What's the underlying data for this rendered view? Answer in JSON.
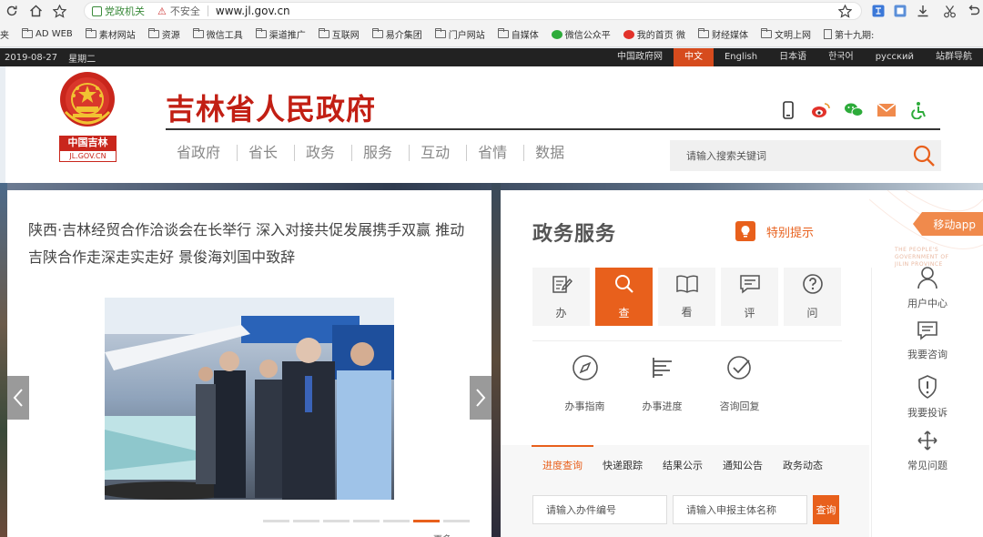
{
  "browser": {
    "badge": "党政机关",
    "insecure": "不安全",
    "url": "www.jl.gov.cn"
  },
  "bookmarks": [
    {
      "label": "夹",
      "icon": "none"
    },
    {
      "label": "AD WEB",
      "icon": "folder-icon"
    },
    {
      "label": "素材网站",
      "icon": "folder-icon"
    },
    {
      "label": "资源",
      "icon": "folder-icon"
    },
    {
      "label": "微信工具",
      "icon": "folder-icon"
    },
    {
      "label": "渠道推广",
      "icon": "folder-icon"
    },
    {
      "label": "互联网",
      "icon": "folder-icon"
    },
    {
      "label": "易介集团",
      "icon": "folder-icon"
    },
    {
      "label": "门户网站",
      "icon": "folder-icon"
    },
    {
      "label": "自媒体",
      "icon": "folder-icon"
    },
    {
      "label": "微信公众平",
      "icon": "wechat-icon"
    },
    {
      "label": "我的首页 微",
      "icon": "weibo-icon"
    },
    {
      "label": "财经媒体",
      "icon": "folder-icon"
    },
    {
      "label": "文明上网",
      "icon": "folder-icon"
    },
    {
      "label": "第十九期:",
      "icon": "document-icon"
    }
  ],
  "top_strip": {
    "date": "2019-08-27",
    "weekday": "星期二",
    "links": [
      {
        "label": "中国政府网",
        "active": false
      },
      {
        "label": "中文",
        "active": true
      },
      {
        "label": "English",
        "active": false
      },
      {
        "label": "日本语",
        "active": false
      },
      {
        "label": "한국어",
        "active": false
      },
      {
        "label": "русский",
        "active": false
      },
      {
        "label": "站群导航",
        "active": false
      }
    ]
  },
  "header": {
    "emblem_label": "中国吉林",
    "emblem_domain": "JL.GOV.CN",
    "title": "吉林省人民政府",
    "nav": [
      "省政府",
      "省长",
      "政务",
      "服务",
      "互动",
      "省情",
      "数据"
    ],
    "search_placeholder": "请输入搜索关键词"
  },
  "news": {
    "headline": "陕西·吉林经贸合作洽谈会在长举行 深入对接共促发展携手双赢 推动吉陕合作走深走实走好 景俊海刘国中致辞",
    "slide_count": 7,
    "active_slide": 6,
    "more": "更多"
  },
  "services": {
    "title": "政务服务",
    "notice": "特别提示",
    "tabs": [
      {
        "label": "办",
        "icon": "edit-icon",
        "active": false
      },
      {
        "label": "查",
        "icon": "search-icon",
        "active": true
      },
      {
        "label": "看",
        "icon": "book-icon",
        "active": false
      },
      {
        "label": "评",
        "icon": "comment-icon",
        "active": false
      },
      {
        "label": "问",
        "icon": "question-icon",
        "active": false
      }
    ],
    "quick": [
      {
        "label": "办事指南",
        "icon": "compass-icon"
      },
      {
        "label": "办事进度",
        "icon": "progress-icon"
      },
      {
        "label": "咨询回复",
        "icon": "check-circle-icon"
      }
    ],
    "query_tabs": [
      {
        "label": "进度查询",
        "active": true
      },
      {
        "label": "快递跟踪",
        "active": false
      },
      {
        "label": "结果公示",
        "active": false
      },
      {
        "label": "通知公告",
        "active": false
      },
      {
        "label": "政务动态",
        "active": false
      }
    ],
    "input_case_placeholder": "请输入办件编号",
    "input_applicant_placeholder": "请输入申报主体名称",
    "query_button": "查询"
  },
  "side": {
    "mobile_app": "移动app",
    "watermark": "THE PEOPLE'S GOVERNMENT OF JILIN PROVINCE",
    "items": [
      {
        "label": "用户中心",
        "icon": "user-icon"
      },
      {
        "label": "我要咨询",
        "icon": "chat-icon"
      },
      {
        "label": "我要投诉",
        "icon": "shield-alert-icon"
      },
      {
        "label": "常见问题",
        "icon": "move-icon"
      }
    ]
  },
  "colors": {
    "brand_red": "#c21f14",
    "accent_orange": "#e8601c",
    "strip_dark": "#222222"
  }
}
